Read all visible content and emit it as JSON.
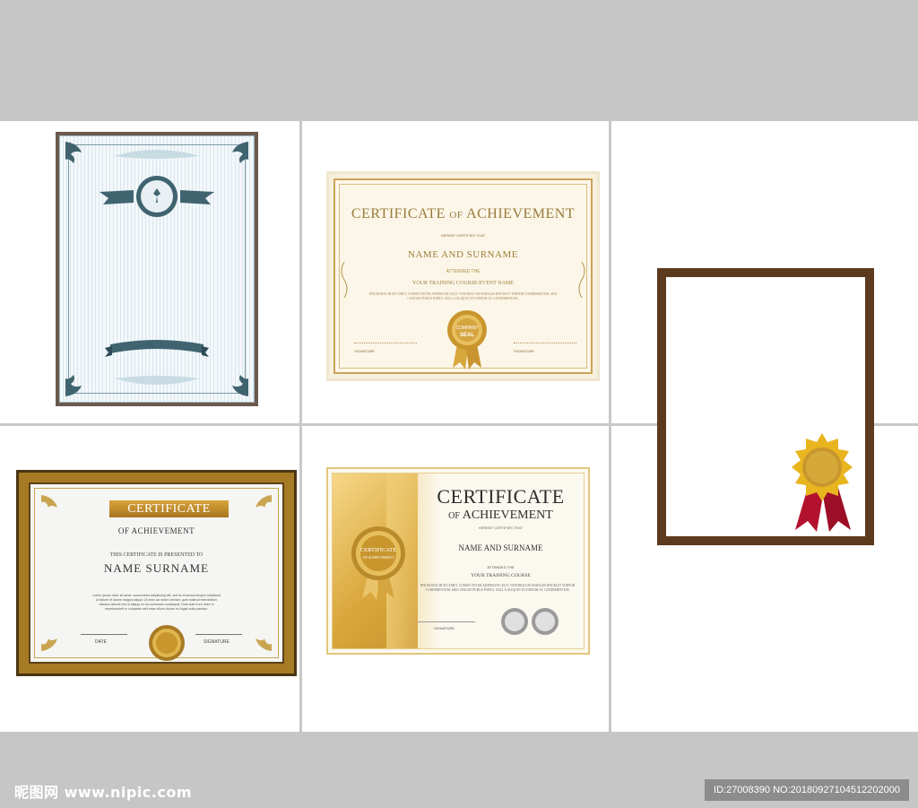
{
  "certificates": {
    "cert2": {
      "title_a": "Certificate",
      "title_of": "of",
      "title_b": "Achievement",
      "certifies": "Hereby certifies that",
      "name": "Name and Surname",
      "attended": "attended the",
      "course": "Your Training Course/Event Name",
      "body": "Ipsum dolor sit amet, consectetur adipiscing elit. Vestibulum sodales ipsum et tortor condimentum, sed congue purus porta. Nulla aliquet in tortor ac condimentum.",
      "seal_line1": "COMPANY",
      "seal_line2": "SEAL",
      "signature": "Signature",
      "signature2": "Signature"
    },
    "cert3": {
      "banner": "CERTIFICATE",
      "of": "OF ACHIEVEMENT",
      "presented": "THIS CERTIFICATE IS PRESENTED TO",
      "name": "NAME  SURNAME",
      "body": "Lorem ipsum dolor sit amet, consectetur adipisicing elit, sed do eiusmod tempor incididunt ut labore et dolore magna aliqua. Ut enim ad minim veniam, quis nostrud exercitation ullamco laboris nisi ut aliquip ex ea commodo consequat. Duis aute irure dolor in reprehenderit in voluptate velit esse cillum dolore eu fugiat nulla pariatur.",
      "date": "DATE",
      "signature": "SIGNATURE"
    },
    "cert4": {
      "title_a": "Certificate",
      "title_of": "of",
      "title_b": "Achievement",
      "certifies": "Hereby certifies that",
      "name": "Name and Surname",
      "attended": "attended the",
      "course": "Your Training Course",
      "body": "Ipsum dolor sit amet, consectetur adipiscing elit. Vestibulum sodales ipsum et tortor condimentum, sed congue purus porta. Nulla aliquet in tortor ac condimentum.",
      "badge_line1": "CERTIFICATE",
      "badge_line2": "OF ACHIEVEMENT",
      "signature": "Signature"
    }
  },
  "footer": {
    "logo": "昵图网 www.nipic.com",
    "id": "ID:27008390 NO:20180927104512202000"
  },
  "colors": {
    "page_bg": "#c6c6c6",
    "gold": "#c9a35a",
    "teal": "#3f6470",
    "brown_frame": "#5b3a1e",
    "ribbon_red": "#b3122e"
  }
}
